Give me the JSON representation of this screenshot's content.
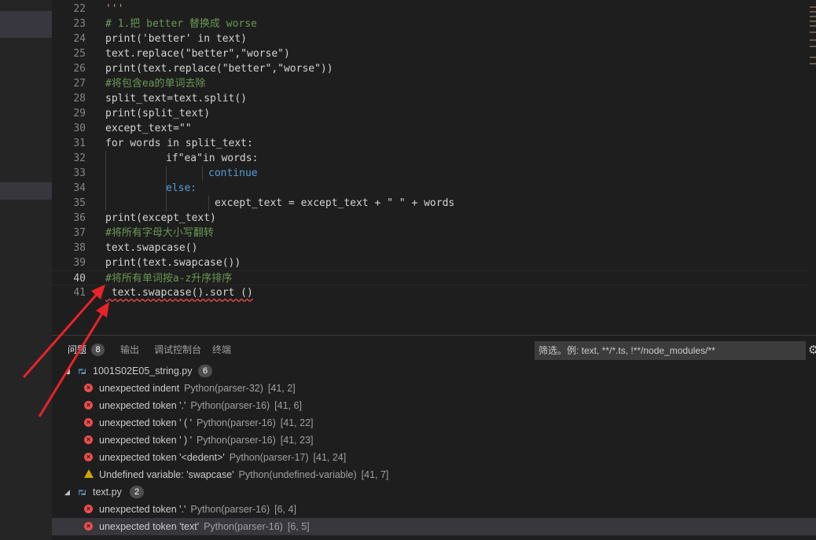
{
  "editor": {
    "lines": [
      {
        "num": "22",
        "text": "'''"
      },
      {
        "num": "23",
        "text": "# 1.把 better 替换成 worse"
      },
      {
        "num": "24",
        "text": "print('better' in text)"
      },
      {
        "num": "25",
        "text": "text.replace(\"better\",\"worse\")"
      },
      {
        "num": "26",
        "text": "print(text.replace(\"better\",\"worse\"))"
      },
      {
        "num": "27",
        "text": "#将包含ea的单词去除"
      },
      {
        "num": "28",
        "text": "split_text=text.split()"
      },
      {
        "num": "29",
        "text": "print(split_text)"
      },
      {
        "num": "30",
        "text": "except_text=\"\""
      },
      {
        "num": "31",
        "text": "for words in split_text:"
      },
      {
        "num": "32",
        "text": "if\"ea\"in words:"
      },
      {
        "num": "33",
        "text": "continue"
      },
      {
        "num": "34",
        "text": "else:"
      },
      {
        "num": "35",
        "text": "except_text = except_text + \" \" + words"
      },
      {
        "num": "36",
        "text": "print(except_text)"
      },
      {
        "num": "37",
        "text": "#将所有字母大小写翻转"
      },
      {
        "num": "38",
        "text": "text.swapcase()"
      },
      {
        "num": "39",
        "text": "print(text.swapcase())"
      },
      {
        "num": "40",
        "text": "#将所有单词按a-z升序排序"
      },
      {
        "num": "41",
        "text": " text.swapcase().sort ()"
      }
    ]
  },
  "panel": {
    "tabs": {
      "problems": "问题",
      "problems_count": "8",
      "output": "输出",
      "debug_console": "调试控制台",
      "terminal": "终端"
    },
    "filter_placeholder": "筛选。例: text, **/*.ts, !**/node_modules/**",
    "files": [
      {
        "name": "1001S02E05_string.py",
        "count": "6",
        "problems": [
          {
            "severity": "error",
            "message": "unexpected indent",
            "source": "Python(parser-32)",
            "position": "[41, 2]"
          },
          {
            "severity": "error",
            "message": "unexpected token '.'",
            "source": "Python(parser-16)",
            "position": "[41, 6]"
          },
          {
            "severity": "error",
            "message": "unexpected token ' ( '",
            "source": "Python(parser-16)",
            "position": "[41, 22]"
          },
          {
            "severity": "error",
            "message": "unexpected token ' ) '",
            "source": "Python(parser-16)",
            "position": "[41, 23]"
          },
          {
            "severity": "error",
            "message": "unexpected token '<dedent>'",
            "source": "Python(parser-17)",
            "position": "[41, 24]"
          },
          {
            "severity": "warning",
            "message": "Undefined variable: 'swapcase'",
            "source": "Python(undefined-variable)",
            "position": "[41, 7]"
          }
        ]
      },
      {
        "name": "text.py",
        "count": "2",
        "problems": [
          {
            "severity": "error",
            "message": "unexpected token '.'",
            "source": "Python(parser-16)",
            "position": "[6, 4]"
          },
          {
            "severity": "error",
            "message": "unexpected token 'text'",
            "source": "Python(parser-16)",
            "position": "[6, 5]"
          }
        ]
      }
    ]
  },
  "colors": {
    "arrow": "#e8232a",
    "error": "#f14c4c",
    "warning": "#cca700"
  }
}
